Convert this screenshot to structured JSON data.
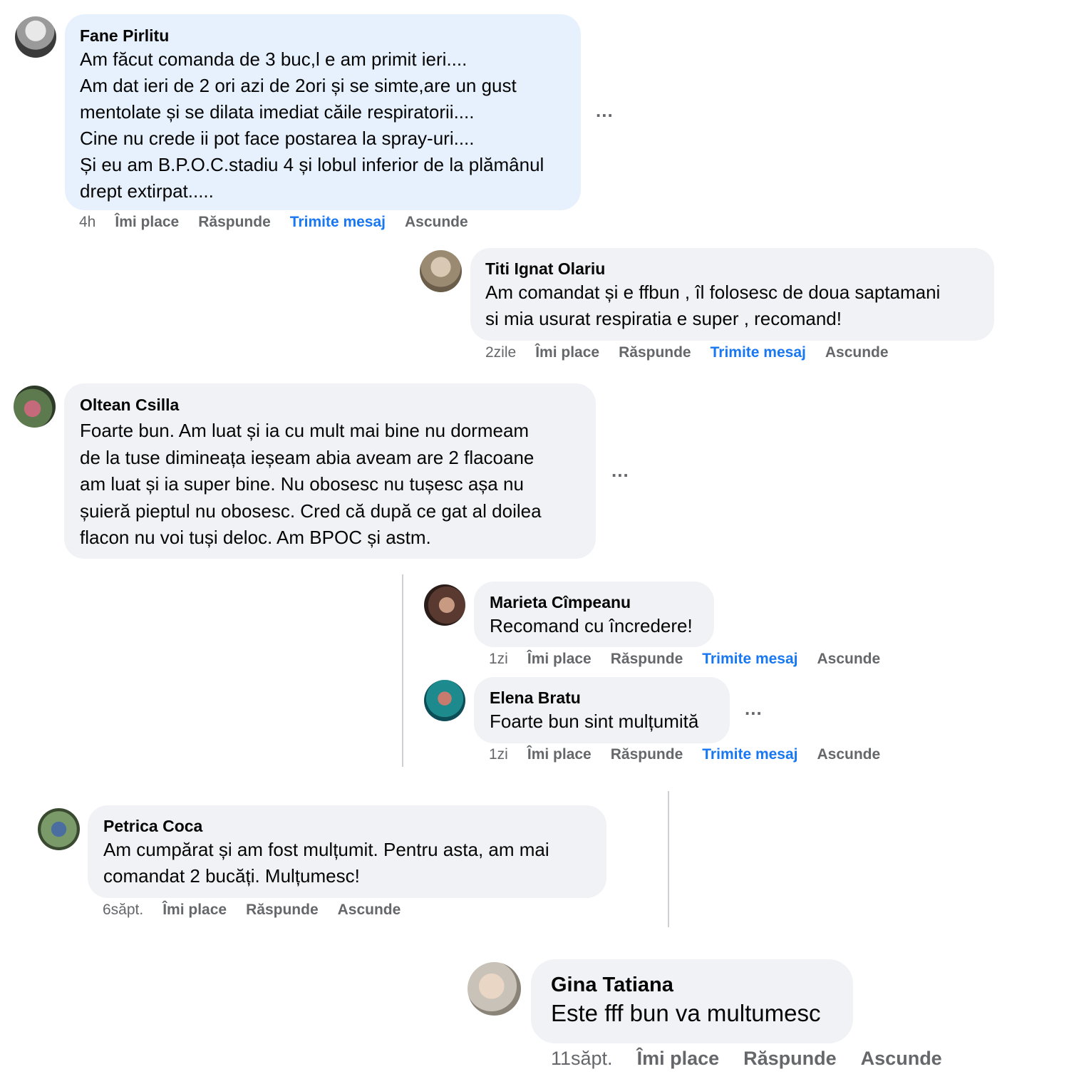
{
  "comments": [
    {
      "author": "Fane Pirlitu",
      "text": "Am făcut comanda de 3 buc,l e am primit ieri....\nAm dat ieri de 2 ori azi de 2ori și se simte,are un gust\nmentolate și se dilata imediat căile respiratorii....\nCine nu crede ii pot face postarea la spray-uri....\nȘi eu am B.P.O.C.stadiu 4 și lobul inferior de la plămânul\ndrept extirpat.....",
      "time": "4h",
      "like": "Îmi place",
      "reply": "Răspunde",
      "message": "Trimite mesaj",
      "hide": "Ascunde",
      "more": "..."
    },
    {
      "author": "Titi Ignat Olariu",
      "text": "Am comandat și e ffbun , îl folosesc de doua saptamani\nsi mia usurat respiratia e super , recomand!",
      "time": "2zile",
      "like": "Îmi place",
      "reply": "Răspunde",
      "message": "Trimite mesaj",
      "hide": "Ascunde"
    },
    {
      "author": "Oltean Csilla",
      "text": "Foarte bun. Am luat și ia cu mult mai bine nu dormeam\nde la tuse dimineața ieșeam abia aveam are 2 flacoane\nam luat și ia super bine. Nu obosesc nu tușesc așa nu\nșuieră pieptul nu obosesc. Cred că după ce gat al doilea\nflacon nu voi tuși deloc. Am BPOC și astm.",
      "more": "..."
    },
    {
      "author": "Marieta Cîmpeanu",
      "text": "Recomand cu încredere!",
      "time": "1zi",
      "like": "Îmi place",
      "reply": "Răspunde",
      "message": "Trimite mesaj",
      "hide": "Ascunde"
    },
    {
      "author": "Elena Bratu",
      "text": "Foarte bun sint mulțumită",
      "time": "1zi",
      "like": "Îmi place",
      "reply": "Răspunde",
      "message": "Trimite mesaj",
      "hide": "Ascunde",
      "more": "..."
    },
    {
      "author": "Petrica Coca",
      "text": "Am cumpărat și am fost mulțumit. Pentru asta, am mai\ncomandat 2 bucăți. Mulțumesc!",
      "time": "6săpt.",
      "like": "Îmi place",
      "reply": "Răspunde",
      "hide": "Ascunde"
    },
    {
      "author": "Gina Tatiana",
      "text": "Este fff bun va multumesc",
      "time": "11săpt.",
      "like": "Îmi place",
      "reply": "Răspunde",
      "hide": "Ascunde"
    }
  ]
}
